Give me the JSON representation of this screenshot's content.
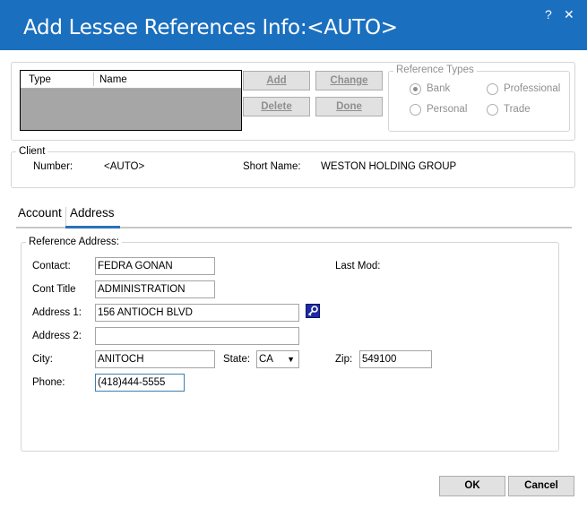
{
  "window": {
    "title": "Add Lessee References Info:<AUTO>",
    "help_glyph": "?",
    "close_glyph": "✕"
  },
  "references_grid": {
    "columns": [
      "Type",
      "Name"
    ]
  },
  "buttons": {
    "add": "Add",
    "change": "Change",
    "delete": "Delete",
    "done": "Done",
    "ok": "OK",
    "cancel": "Cancel"
  },
  "reference_types": {
    "legend": "Reference Types",
    "options": [
      "Bank",
      "Professional",
      "Personal",
      "Trade"
    ],
    "selected": "Bank"
  },
  "client": {
    "legend": "Client",
    "number_label": "Number:",
    "number_value": "<AUTO>",
    "short_name_label": "Short Name:",
    "short_name_value": "WESTON HOLDING GROUP"
  },
  "tabs": [
    "Account",
    "Address"
  ],
  "active_tab": "Address",
  "reference_address": {
    "legend": "Reference Address:",
    "contact_label": "Contact:",
    "contact_value": "FEDRA GONAN",
    "cont_title_label": "Cont Title",
    "cont_title_value": "ADMINISTRATION",
    "address1_label": "Address 1:",
    "address1_value": "156 ANTIOCH BLVD",
    "address2_label": "Address 2:",
    "address2_value": "",
    "city_label": "City:",
    "city_value": "ANITOCH",
    "state_label": "State:",
    "state_value": "CA",
    "zip_label": "Zip:",
    "zip_value": "549100",
    "phone_label": "Phone:",
    "phone_value": "(418)444-5555",
    "last_mod_label": "Last Mod:"
  },
  "colors": {
    "titlebar": "#1a6fbf",
    "tab_accent": "#2a72b5",
    "grid_body": "#a6a6a6"
  }
}
